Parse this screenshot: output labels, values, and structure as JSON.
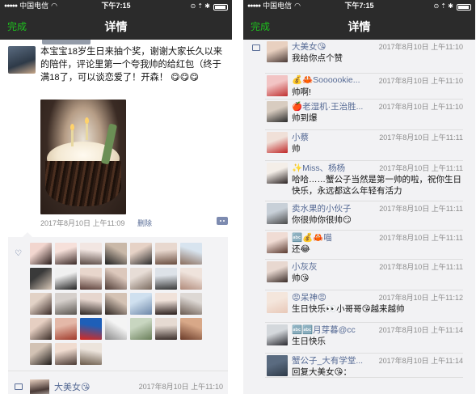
{
  "status_bar": {
    "signal": "●●●●●",
    "carrier": "中国电信",
    "wifi": "◠",
    "time": "下午7:15",
    "icons": "⊙ ⇡ ✱"
  },
  "nav": {
    "done_label": "完成",
    "title": "详情"
  },
  "post": {
    "text": "本宝宝18岁生日来抽个奖，谢谢大家长久以来的陪伴，评论里第一个夸我帅的给红包（终于满18了，可以谈恋爱了！开森！ 😋😋😋",
    "time": "2017年8月10日 上午11:09",
    "delete_label": "删除"
  },
  "likes": {
    "avatars": [
      {
        "c1": "#f2d6cf",
        "c2": "#2a1c1a"
      },
      {
        "c1": "#f6e0da",
        "c2": "#3b2a27"
      },
      {
        "c1": "#f2e6e2",
        "c2": "#5a4a44"
      },
      {
        "c1": "#c9b8a8",
        "c2": "#1e1e1e"
      },
      {
        "c1": "#e6d2c6",
        "c2": "#2b2b2b"
      },
      {
        "c1": "#e8d8cf",
        "c2": "#6a4e40"
      },
      {
        "c1": "#d8e4ef",
        "c2": "#8b6e5d"
      },
      {
        "c1": "#3a3a3a",
        "c2": "#d8c8b8"
      },
      {
        "c1": "#f0f0f0",
        "c2": "#222222"
      },
      {
        "c1": "#e8d6cc",
        "c2": "#5c403a"
      },
      {
        "c1": "#dcc8bc",
        "c2": "#4e3a34"
      },
      {
        "c1": "#e7ddd6",
        "c2": "#7a6a5e"
      },
      {
        "c1": "#dde2e8",
        "c2": "#3a3a3a"
      },
      {
        "c1": "#efe3dc",
        "c2": "#b08a7a"
      },
      {
        "c1": "#e2d2c6",
        "c2": "#3a2a26"
      },
      {
        "c1": "#d6d0cc",
        "c2": "#5a5550"
      },
      {
        "c1": "#e6d6ce",
        "c2": "#2e2622"
      },
      {
        "c1": "#d4c2b4",
        "c2": "#2c2420"
      },
      {
        "c1": "#cfe0ef",
        "c2": "#6d87a8"
      },
      {
        "c1": "#f0e2da",
        "c2": "#2a1e1c"
      },
      {
        "c1": "#ddd8d4",
        "c2": "#6a5a50"
      },
      {
        "c1": "#e6cfc2",
        "c2": "#3a2c26"
      },
      {
        "c1": "#e4b8a8",
        "c2": "#a03a2a"
      },
      {
        "c1": "#1e5fb8",
        "c2": "#d8281e"
      },
      {
        "c1": "#f4f4f4",
        "c2": "#8a8a8a"
      },
      {
        "c1": "#c8d6c0",
        "c2": "#6a7f5a"
      },
      {
        "c1": "#e6dad2",
        "c2": "#3a2e2a"
      },
      {
        "c1": "#d8a888",
        "c2": "#6a3a28"
      },
      {
        "c1": "#d2c2b4",
        "c2": "#1e1a18"
      },
      {
        "c1": "#f0dcd0",
        "c2": "#4a3a34"
      },
      {
        "c1": "#ece4dc",
        "c2": "#6a5a4a"
      }
    ]
  },
  "left_comment": {
    "name": "大美女😘",
    "time": "2017年8月10日 上午11:10"
  },
  "comments": [
    {
      "name": "大美女😘",
      "time": "2017年8月10日 上午11:10",
      "text": "我给你点个赞",
      "c1": "#e8d0c0",
      "c2": "#4a3a36"
    },
    {
      "name": "💰🦀Soooookie...",
      "time": "2017年8月10日 上午11:10",
      "text": "帅啊!",
      "c1": "#f2c4c4",
      "c2": "#c03030"
    },
    {
      "name": "🍎老湿机·王治胜...",
      "time": "2017年8月10日 上午11:10",
      "text": "帅到爆",
      "c1": "#d8ccc0",
      "c2": "#2a2a2a"
    },
    {
      "name": "小蔡",
      "time": "2017年8月10日 上午11:11",
      "text": "帅",
      "c1": "#f0e0d8",
      "c2": "#c02828"
    },
    {
      "name": "✨Miss、杨杨",
      "time": "2017年8月10日 上午11:11",
      "text": "哈哈……蟹公子当然是第一帅的啦，祝你生日快乐，永远都这么年轻有活力",
      "c1": "#f4eee8",
      "c2": "#2a2222"
    },
    {
      "name": "卖水果的小伙子",
      "time": "2017年8月10日 上午11:11",
      "text": "你很帅你很帅😏",
      "c1": "#c8d0d8",
      "c2": "#4a4a4a"
    },
    {
      "name": "🔤💰🦀喵",
      "time": "2017年8月10日 上午11:11",
      "text": "还😂",
      "c1": "#f0dcd4",
      "c2": "#5a3a30"
    },
    {
      "name": "小灰灰",
      "time": "2017年8月10日 上午11:11",
      "text": "帅😘",
      "c1": "#e8d8d0",
      "c2": "#3a2c28"
    },
    {
      "name": "😡呆神😡",
      "time": "2017年8月10日 上午11:12",
      "text": "生日快乐👀小哥哥😘越来越帅",
      "c1": "#f4e6dc",
      "c2": "#e8c8b8"
    },
    {
      "name": "🔤🔤月芽暮@cc",
      "time": "2017年8月10日 上午11:14",
      "text": "生日快乐",
      "c1": "#d4d8dc",
      "c2": "#2a2a30"
    },
    {
      "name": "蟹公子_大有学堂...",
      "time": "2017年8月10日 上午11:14",
      "text": "回复大美女😘：",
      "c1": "#5a6b80",
      "c2": "#2e3a48"
    }
  ]
}
